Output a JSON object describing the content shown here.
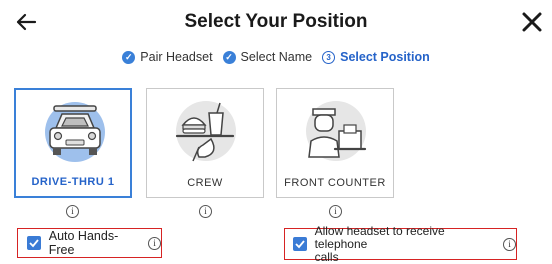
{
  "header": {
    "title": "Select Your Position",
    "back_icon": "arrow-left-icon",
    "close_icon": "close-icon"
  },
  "steps": [
    {
      "label": "Pair Headset",
      "state": "done",
      "marker": "✓"
    },
    {
      "label": "Select Name",
      "state": "done",
      "marker": "✓"
    },
    {
      "label": "Select Position",
      "state": "current",
      "marker": "3"
    }
  ],
  "positions": [
    {
      "label": "DRIVE-THRU 1",
      "selected": true,
      "icon": "car-icon"
    },
    {
      "label": "CREW",
      "selected": false,
      "icon": "food-tray-icon"
    },
    {
      "label": "FRONT COUNTER",
      "selected": false,
      "icon": "cashier-icon"
    }
  ],
  "info_glyph": "i",
  "options": {
    "auto_hands_free": {
      "label": "Auto Hands-Free",
      "checked": true
    },
    "allow_telephone": {
      "label_line1": "Allow headset to receive telephone",
      "label_line2": "calls",
      "checked": true
    }
  },
  "colors": {
    "accent": "#3a80d8",
    "highlight": "#d62323",
    "check_fill": "#3a7bd5"
  }
}
